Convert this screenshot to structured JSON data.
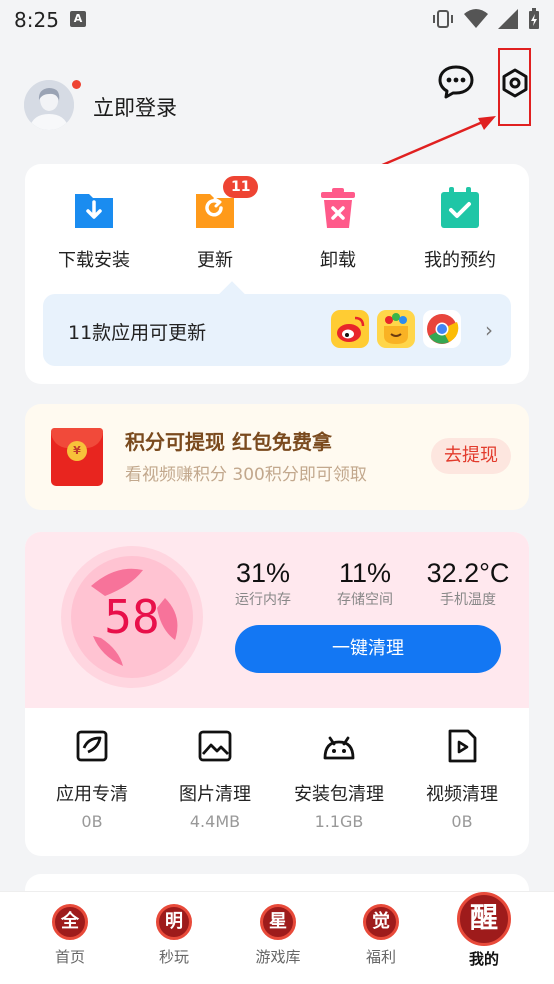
{
  "status_bar": {
    "time": "8:25",
    "notification_icon": "A"
  },
  "header": {
    "login_label": "立即登录",
    "icons": [
      "avatar",
      "message-icon",
      "settings-icon"
    ]
  },
  "quick_actions": [
    {
      "label": "下载安装",
      "icon": "download-icon",
      "color": "#1a8cf0"
    },
    {
      "label": "更新",
      "icon": "update-icon",
      "color": "#ff9a1a",
      "badge": "11"
    },
    {
      "label": "卸载",
      "icon": "uninstall-icon",
      "color": "#ff5a8a"
    },
    {
      "label": "我的预约",
      "icon": "reservation-icon",
      "color": "#1fc6a6"
    }
  ],
  "update_bar": {
    "text": "11款应用可更新",
    "apps": [
      "weibo-app-icon",
      "meipai-app-icon",
      "chrome-app-icon"
    ]
  },
  "promo": {
    "title": "积分可提现 红包免费拿",
    "subtitle": "看视频赚积分 300积分即可领取",
    "button": "去提现",
    "coin_glyph": "¥"
  },
  "cleaner": {
    "score": "58",
    "stats": [
      {
        "value": "31%",
        "label": "运行内存"
      },
      {
        "value": "11%",
        "label": "存储空间"
      },
      {
        "value": "32.2°C",
        "label": "手机温度"
      }
    ],
    "clean_button": "一键清理",
    "tools": [
      {
        "label": "应用专清",
        "size": "0B",
        "icon": "app-clean-icon"
      },
      {
        "label": "图片清理",
        "size": "4.4MB",
        "icon": "image-clean-icon"
      },
      {
        "label": "安装包清理",
        "size": "1.1GB",
        "icon": "package-clean-icon"
      },
      {
        "label": "视频清理",
        "size": "0B",
        "icon": "video-clean-icon"
      }
    ]
  },
  "bottom_nav": [
    {
      "label": "首页",
      "glyph": "全"
    },
    {
      "label": "秒玩",
      "glyph": "明"
    },
    {
      "label": "游戏库",
      "glyph": "星"
    },
    {
      "label": "福利",
      "glyph": "觉"
    },
    {
      "label": "我的",
      "glyph": "醒",
      "active": true
    }
  ],
  "colors": {
    "accent_blue": "#1377f3",
    "annotation_red": "#e02020",
    "badge_red": "#ee4433"
  }
}
